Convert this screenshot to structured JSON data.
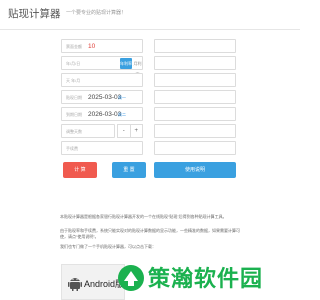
{
  "header": {
    "title": "贴现计算器",
    "subtitle": "一个要专业的贴现计算器！"
  },
  "form": {
    "amount": {
      "label": "票面金额",
      "value": "10",
      "placeholder": ""
    },
    "rate": {
      "label": "年/月/日",
      "mode_on": "年利率",
      "mode_off": "月利率"
    },
    "days_label": "天 年/月",
    "discount_date": {
      "label": "贴现日期",
      "value": "2025-03-03",
      "weekday": "周一"
    },
    "maturity_date": {
      "label": "到期日期",
      "value": "2026-03-03",
      "weekday": "周二"
    },
    "adjust": {
      "label": "调整天数",
      "minus": "-",
      "plus": "+"
    },
    "fee_label": "手续费",
    "right_placeholders": [
      "",
      "",
      "",
      "",
      "",
      "",
      ""
    ]
  },
  "buttons": {
    "calculate": "计 算",
    "reset": "重 置",
    "help": "使用说明"
  },
  "description": {
    "p1": "本贴现计算器是根据各家银行贴现计算器开发的一个在线贴现“贴现”后得到各种贴现计算工具。",
    "p2": "由于贴现率和手续费，系统只能实现对的贴现计算数据的显示功能，一些精准的数据，如果需要计算可使，请点“使用说明”。",
    "p3": "我们也专门做了一个手机贴现计算器，可以点击下载："
  },
  "download": {
    "android_label": "Android版",
    "watermark_title": "策瀚软件园",
    "watermark_sub": ""
  },
  "colors": {
    "accent_blue": "#3aa0e0",
    "accent_red": "#f05a4f",
    "value_red": "#e0403a",
    "watermark_green": "#1bb14f"
  }
}
